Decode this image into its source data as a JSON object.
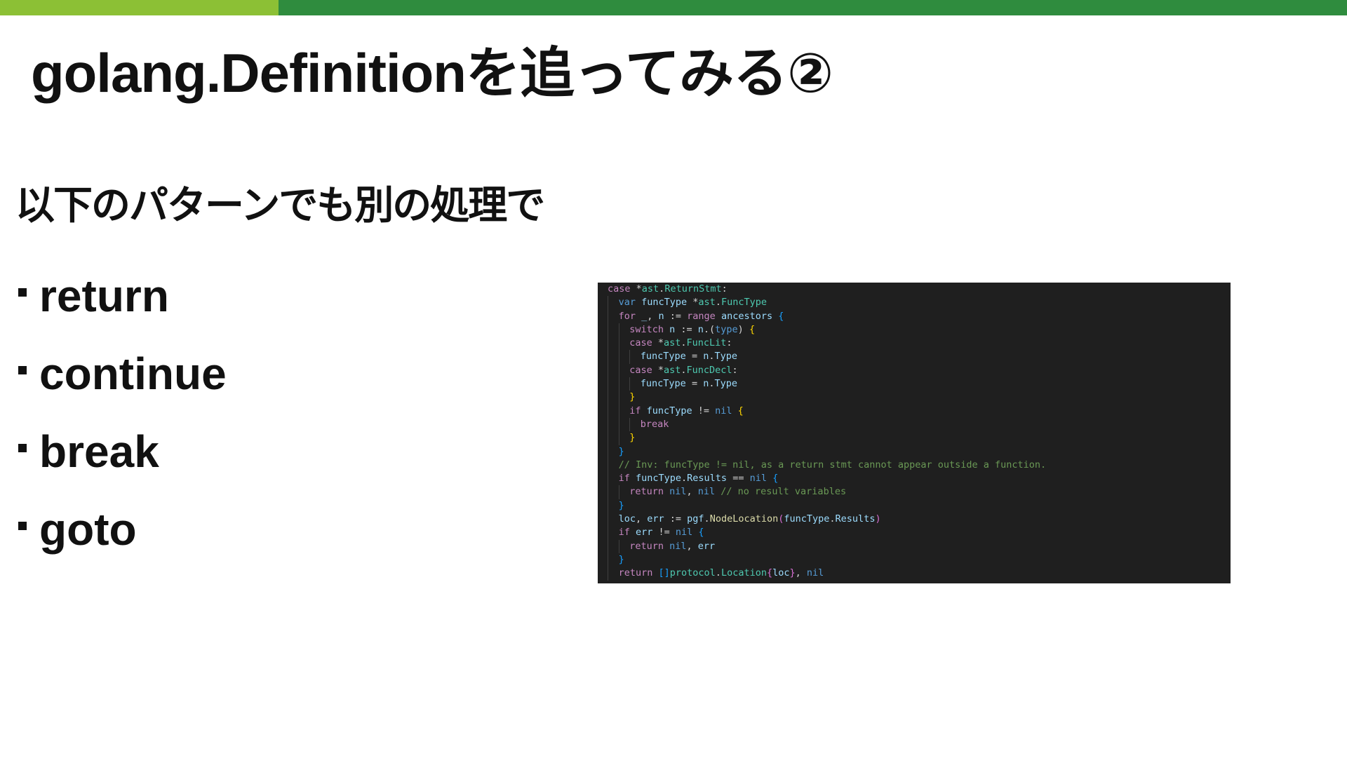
{
  "colors": {
    "bar_left": "#8cc035",
    "bar_right": "#2f8c3e",
    "code_background": "#1f1f1f"
  },
  "slide": {
    "title": "golang.Definitionを追ってみる②",
    "subtitle": "以下のパターンでも別の処理で",
    "bullets": [
      {
        "label": "return"
      },
      {
        "label": "continue"
      },
      {
        "label": "break"
      },
      {
        "label": "goto"
      }
    ]
  },
  "code": {
    "lines": [
      {
        "indent": 0,
        "tokens": [
          {
            "t": "case ",
            "c": "kw"
          },
          {
            "t": "*",
            "c": "op"
          },
          {
            "t": "ast",
            "c": "ty"
          },
          {
            "t": ".",
            "c": "op"
          },
          {
            "t": "ReturnStmt",
            "c": "ty"
          },
          {
            "t": ":",
            "c": "op"
          }
        ]
      },
      {
        "indent": 1,
        "tokens": [
          {
            "t": "var ",
            "c": "kw2"
          },
          {
            "t": "funcType ",
            "c": "var"
          },
          {
            "t": "*",
            "c": "op"
          },
          {
            "t": "ast",
            "c": "ty"
          },
          {
            "t": ".",
            "c": "op"
          },
          {
            "t": "FuncType",
            "c": "ty"
          }
        ]
      },
      {
        "indent": 1,
        "tokens": [
          {
            "t": "for ",
            "c": "kw"
          },
          {
            "t": "_",
            "c": "var"
          },
          {
            "t": ", ",
            "c": "op"
          },
          {
            "t": "n ",
            "c": "var"
          },
          {
            "t": ":= ",
            "c": "op"
          },
          {
            "t": "range ",
            "c": "kw"
          },
          {
            "t": "ancestors ",
            "c": "var"
          },
          {
            "t": "{",
            "c": "br3"
          }
        ]
      },
      {
        "indent": 2,
        "tokens": [
          {
            "t": "switch ",
            "c": "kw"
          },
          {
            "t": "n ",
            "c": "var"
          },
          {
            "t": ":= ",
            "c": "op"
          },
          {
            "t": "n",
            "c": "var"
          },
          {
            "t": ".(",
            "c": "op"
          },
          {
            "t": "type",
            "c": "kw2"
          },
          {
            "t": ") ",
            "c": "op"
          },
          {
            "t": "{",
            "c": "br1"
          }
        ]
      },
      {
        "indent": 2,
        "tokens": [
          {
            "t": "case ",
            "c": "kw"
          },
          {
            "t": "*",
            "c": "op"
          },
          {
            "t": "ast",
            "c": "ty"
          },
          {
            "t": ".",
            "c": "op"
          },
          {
            "t": "FuncLit",
            "c": "ty"
          },
          {
            "t": ":",
            "c": "op"
          }
        ]
      },
      {
        "indent": 3,
        "tokens": [
          {
            "t": "funcType ",
            "c": "var"
          },
          {
            "t": "= ",
            "c": "op"
          },
          {
            "t": "n",
            "c": "var"
          },
          {
            "t": ".",
            "c": "op"
          },
          {
            "t": "Type",
            "c": "var"
          }
        ]
      },
      {
        "indent": 2,
        "tokens": [
          {
            "t": "case ",
            "c": "kw"
          },
          {
            "t": "*",
            "c": "op"
          },
          {
            "t": "ast",
            "c": "ty"
          },
          {
            "t": ".",
            "c": "op"
          },
          {
            "t": "FuncDecl",
            "c": "ty"
          },
          {
            "t": ":",
            "c": "op"
          }
        ]
      },
      {
        "indent": 3,
        "tokens": [
          {
            "t": "funcType ",
            "c": "var"
          },
          {
            "t": "= ",
            "c": "op"
          },
          {
            "t": "n",
            "c": "var"
          },
          {
            "t": ".",
            "c": "op"
          },
          {
            "t": "Type",
            "c": "var"
          }
        ]
      },
      {
        "indent": 2,
        "tokens": [
          {
            "t": "}",
            "c": "br1"
          }
        ]
      },
      {
        "indent": 2,
        "tokens": [
          {
            "t": "if ",
            "c": "kw"
          },
          {
            "t": "funcType ",
            "c": "var"
          },
          {
            "t": "!= ",
            "c": "op"
          },
          {
            "t": "nil ",
            "c": "kw2"
          },
          {
            "t": "{",
            "c": "br1"
          }
        ]
      },
      {
        "indent": 3,
        "tokens": [
          {
            "t": "break",
            "c": "kw"
          }
        ]
      },
      {
        "indent": 2,
        "tokens": [
          {
            "t": "}",
            "c": "br1"
          }
        ]
      },
      {
        "indent": 1,
        "tokens": [
          {
            "t": "}",
            "c": "br3"
          }
        ]
      },
      {
        "indent": 1,
        "tokens": [
          {
            "t": "// Inv: funcType != nil, as a return stmt cannot appear outside a function.",
            "c": "cm"
          }
        ]
      },
      {
        "indent": 1,
        "tokens": [
          {
            "t": "if ",
            "c": "kw"
          },
          {
            "t": "funcType",
            "c": "var"
          },
          {
            "t": ".",
            "c": "op"
          },
          {
            "t": "Results ",
            "c": "var"
          },
          {
            "t": "== ",
            "c": "op"
          },
          {
            "t": "nil ",
            "c": "kw2"
          },
          {
            "t": "{",
            "c": "br3"
          }
        ]
      },
      {
        "indent": 2,
        "tokens": [
          {
            "t": "return ",
            "c": "kw"
          },
          {
            "t": "nil",
            "c": "kw2"
          },
          {
            "t": ", ",
            "c": "op"
          },
          {
            "t": "nil ",
            "c": "kw2"
          },
          {
            "t": "// no result variables",
            "c": "cm"
          }
        ]
      },
      {
        "indent": 1,
        "tokens": [
          {
            "t": "}",
            "c": "br3"
          }
        ]
      },
      {
        "indent": 1,
        "tokens": [
          {
            "t": "loc",
            "c": "var"
          },
          {
            "t": ", ",
            "c": "op"
          },
          {
            "t": "err ",
            "c": "var"
          },
          {
            "t": ":= ",
            "c": "op"
          },
          {
            "t": "pgf",
            "c": "var"
          },
          {
            "t": ".",
            "c": "op"
          },
          {
            "t": "NodeLocation",
            "c": "fn"
          },
          {
            "t": "(",
            "c": "br2"
          },
          {
            "t": "funcType",
            "c": "var"
          },
          {
            "t": ".",
            "c": "op"
          },
          {
            "t": "Results",
            "c": "var"
          },
          {
            "t": ")",
            "c": "br2"
          }
        ]
      },
      {
        "indent": 1,
        "tokens": [
          {
            "t": "if ",
            "c": "kw"
          },
          {
            "t": "err ",
            "c": "var"
          },
          {
            "t": "!= ",
            "c": "op"
          },
          {
            "t": "nil ",
            "c": "kw2"
          },
          {
            "t": "{",
            "c": "br3"
          }
        ]
      },
      {
        "indent": 2,
        "tokens": [
          {
            "t": "return ",
            "c": "kw"
          },
          {
            "t": "nil",
            "c": "kw2"
          },
          {
            "t": ", ",
            "c": "op"
          },
          {
            "t": "err",
            "c": "var"
          }
        ]
      },
      {
        "indent": 1,
        "tokens": [
          {
            "t": "}",
            "c": "br3"
          }
        ]
      },
      {
        "indent": 1,
        "tokens": [
          {
            "t": "return ",
            "c": "kw"
          },
          {
            "t": "[]",
            "c": "br3"
          },
          {
            "t": "protocol",
            "c": "ty"
          },
          {
            "t": ".",
            "c": "op"
          },
          {
            "t": "Location",
            "c": "ty"
          },
          {
            "t": "{",
            "c": "br2"
          },
          {
            "t": "loc",
            "c": "var"
          },
          {
            "t": "}",
            "c": "br2"
          },
          {
            "t": ", ",
            "c": "op"
          },
          {
            "t": "nil",
            "c": "kw2"
          }
        ]
      }
    ]
  }
}
